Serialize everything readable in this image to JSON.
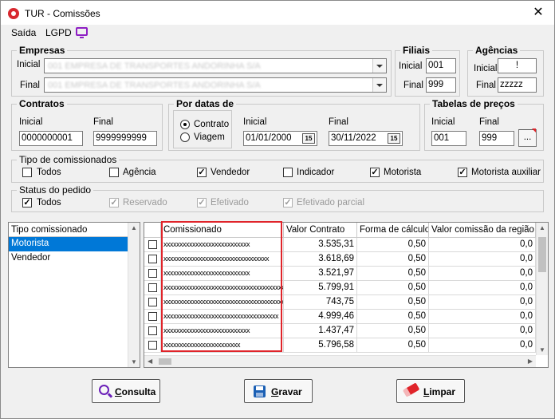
{
  "window": {
    "title": "TUR - Comissões"
  },
  "menu": {
    "items": [
      "Saída",
      "LGPD"
    ]
  },
  "empresas": {
    "legend": "Empresas",
    "inicial_label": "Inicial",
    "final_label": "Final",
    "inicial_value": "001 EMPRESA DE TRANSPORTES ANDORINHA S/A",
    "final_value": "001 EMPRESA DE TRANSPORTES ANDORINHA S/A"
  },
  "filiais": {
    "legend": "Filiais",
    "inicial_label": "Inicial",
    "final_label": "Final",
    "inicial_value": "001",
    "final_value": "999"
  },
  "agencias": {
    "legend": "Agências",
    "inicial_label": "Inicial",
    "final_label": "Final",
    "inicial_value": "!",
    "final_value": "zzzzz"
  },
  "contratos": {
    "legend": "Contratos",
    "inicial_label": "Inicial",
    "final_label": "Final",
    "inicial_value": "0000000001",
    "final_value": "9999999999"
  },
  "datas": {
    "legend": "Por datas de",
    "options": [
      "Contrato",
      "Viagem"
    ],
    "selected": "Contrato",
    "inicial_label": "Inicial",
    "final_label": "Final",
    "inicial_value": "01/01/2000",
    "final_value": "30/11/2022",
    "calendar_glyph": "15"
  },
  "tabelas": {
    "legend": "Tabelas de preços",
    "inicial_label": "Inicial",
    "final_label": "Final",
    "inicial_value": "001",
    "final_value": "999",
    "lookup_label": "..."
  },
  "tipo_comissionados": {
    "legend": "Tipo de comissionados",
    "options": [
      {
        "label": "Todos",
        "checked": false
      },
      {
        "label": "Agência",
        "checked": false
      },
      {
        "label": "Vendedor",
        "checked": true
      },
      {
        "label": "Indicador",
        "checked": false
      },
      {
        "label": "Motorista",
        "checked": true
      },
      {
        "label": "Motorista auxiliar",
        "checked": true
      }
    ]
  },
  "status_pedido": {
    "legend": "Status do pedido",
    "options": [
      {
        "label": "Todos",
        "checked": true,
        "disabled": false
      },
      {
        "label": "Reservado",
        "checked": true,
        "disabled": true
      },
      {
        "label": "Efetivado",
        "checked": true,
        "disabled": true
      },
      {
        "label": "Efetivado parcial",
        "checked": true,
        "disabled": true
      }
    ]
  },
  "tipo_list": {
    "header": "Tipo comissionado",
    "items": [
      "Motorista",
      "Vendedor"
    ],
    "selected_index": 0
  },
  "grid": {
    "columns": [
      "Comissionado",
      "Valor Contrato",
      "Forma de cálculo",
      "Valor comissão da região"
    ],
    "rows": [
      {
        "comissionado": "xxxxxxxxxxxxxxxxxxxxxxxxxxx",
        "valor": "3.535,31",
        "forma": "0,50",
        "regiao": "0,0"
      },
      {
        "comissionado": "xxxxxxxxxxxxxxxxxxxxxxxxxxxxxxxxx",
        "valor": "3.618,69",
        "forma": "0,50",
        "regiao": "0,0"
      },
      {
        "comissionado": "xxxxxxxxxxxxxxxxxxxxxxxxxxx",
        "valor": "3.521,97",
        "forma": "0,50",
        "regiao": "0,0"
      },
      {
        "comissionado": "xxxxxxxxxxxxxxxxxxxxxxxxxxxxxxxxxxxxxxxx",
        "valor": "5.799,91",
        "forma": "0,50",
        "regiao": "0,0"
      },
      {
        "comissionado": "xxxxxxxxxxxxxxxxxxxxxxxxxxxxxxxxxxxxxxxxx",
        "valor": "743,75",
        "forma": "0,50",
        "regiao": "0,0"
      },
      {
        "comissionado": "xxxxxxxxxxxxxxxxxxxxxxxxxxxxxxxxxxxx",
        "valor": "4.999,46",
        "forma": "0,50",
        "regiao": "0,0"
      },
      {
        "comissionado": "xxxxxxxxxxxxxxxxxxxxxxxxxxx",
        "valor": "1.437,47",
        "forma": "0,50",
        "regiao": "0,0"
      },
      {
        "comissionado": "xxxxxxxxxxxxxxxxxxxxxxxx",
        "valor": "5.796,58",
        "forma": "0,50",
        "regiao": "0,0"
      }
    ]
  },
  "buttons": {
    "consulta": {
      "first": "C",
      "rest": "onsulta"
    },
    "gravar": {
      "first": "G",
      "rest": "ravar"
    },
    "limpar": {
      "first": "L",
      "rest": "impar"
    }
  },
  "colors": {
    "selection": "#0078d7",
    "highlight_box": "#e0242a",
    "lgpd_icon": "#8e1fc4"
  }
}
